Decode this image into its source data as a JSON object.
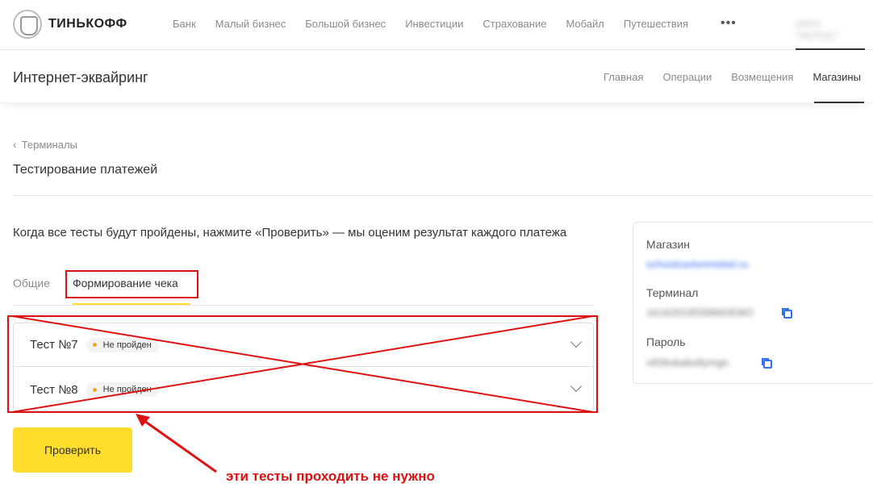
{
  "brand": {
    "name": "ТИНЬКОФФ"
  },
  "nav": {
    "items": [
      "Банк",
      "Малый бизнес",
      "Большой бизнес",
      "Инвестиции",
      "Страхование",
      "Мобайл",
      "Путешествия"
    ],
    "more": "•••",
    "user": "ООО \"ЛОТОС\""
  },
  "section": {
    "title": "Интернет-эквайринг",
    "nav": [
      "Главная",
      "Операции",
      "Возмещения",
      "Магазины"
    ]
  },
  "breadcrumb": {
    "label": "Терминалы"
  },
  "page": {
    "title": "Тестирование платежей",
    "intro": "Когда все тесты будут пройдены, нажмите «Проверить» — мы оценим результат каждого платежа"
  },
  "tabs": {
    "general": "Общие",
    "receipt": "Формирование чека"
  },
  "tests": [
    {
      "name": "Тест №7",
      "status": "Не пройден"
    },
    {
      "name": "Тест №8",
      "status": "Не пройден"
    }
  ],
  "check_button": "Проверить",
  "annotation": "эти тесты проходить не нужно",
  "store_card": {
    "store_label": "Магазин",
    "store_value": "schoolzavtonmebel.ru",
    "terminal_label": "Терминал",
    "terminal_value": "1616291955886DEMO",
    "password_label": "Пароль",
    "password_value": "v836xbabx8ymgn"
  },
  "colors": {
    "accent": "#ffdd2d",
    "annotation": "#dd1111",
    "link": "#336fee",
    "status_dot": "#f5a623"
  },
  "icons": {
    "logo": "coat-of-arms-icon",
    "back": "chevron-left-icon",
    "expand": "chevron-down-icon",
    "copy": "copy-icon"
  }
}
